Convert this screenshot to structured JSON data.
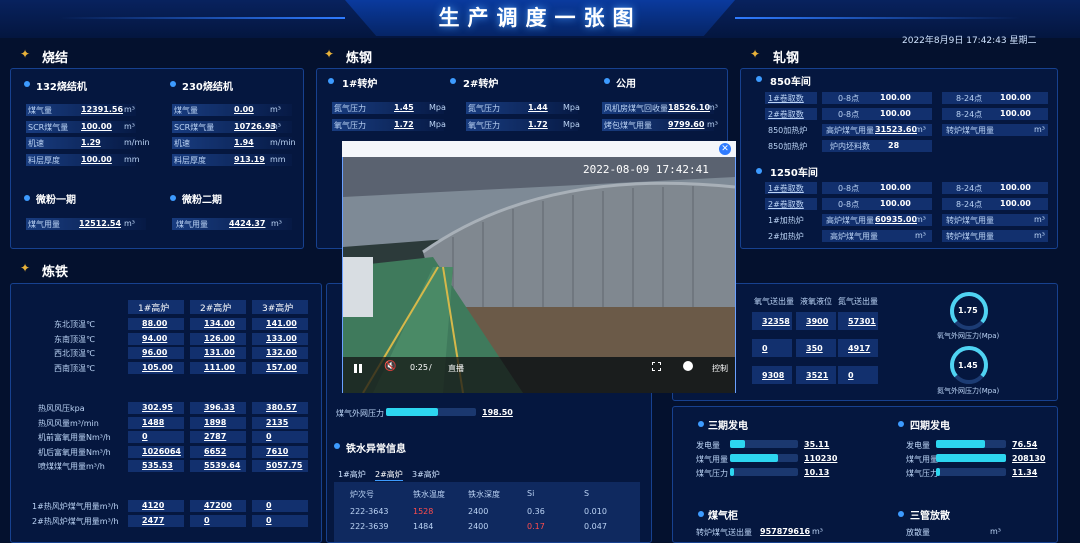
{
  "title": "生产调度一张图",
  "datetime": "2022年8月9日 17:42:43 星期二",
  "sinter": {
    "title": "烧结",
    "m132": {
      "title": "132烧结机",
      "rows": [
        {
          "l": "煤气量",
          "v": "12391.56",
          "u": "m³"
        },
        {
          "l": "SCR煤气量",
          "v": "100.00",
          "u": "m³"
        },
        {
          "l": "机速",
          "v": "1.29",
          "u": "m/min"
        },
        {
          "l": "料层厚度",
          "v": "100.00",
          "u": "mm"
        }
      ]
    },
    "m230": {
      "title": "230烧结机",
      "rows": [
        {
          "l": "煤气量",
          "v": "0.00",
          "u": "m³"
        },
        {
          "l": "SCR煤气量",
          "v": "10726.93",
          "u": "m³"
        },
        {
          "l": "机速",
          "v": "1.94",
          "u": "m/min"
        },
        {
          "l": "料层厚度",
          "v": "913.19",
          "u": "mm"
        }
      ]
    },
    "w1": {
      "title": "微粉一期",
      "l": "煤气用量",
      "v": "12512.54",
      "u": "m³"
    },
    "w2": {
      "title": "微粉二期",
      "l": "煤气用量",
      "v": "4424.37",
      "u": "m³"
    }
  },
  "steel": {
    "title": "炼钢",
    "c1": {
      "title": "1#转炉",
      "rows": [
        {
          "l": "氮气压力",
          "v": "1.45",
          "u": "Mpa"
        },
        {
          "l": "氧气压力",
          "v": "1.72",
          "u": "Mpa"
        }
      ]
    },
    "c2": {
      "title": "2#转炉",
      "rows": [
        {
          "l": "氮气压力",
          "v": "1.44",
          "u": "Mpa"
        },
        {
          "l": "氧气压力",
          "v": "1.72",
          "u": "Mpa"
        }
      ]
    },
    "pub": {
      "title": "公用",
      "rows": [
        {
          "l": "风机房煤气回收量",
          "v": "18526.10",
          "u": "m³"
        },
        {
          "l": "烤包煤气用量",
          "v": "9799.60",
          "u": "m³"
        }
      ]
    }
  },
  "roll": {
    "title": "轧钢",
    "w850": {
      "title": "850车间",
      "rows": [
        {
          "a": "1#卷取数",
          "b": "0-8点",
          "c": "100.00",
          "d": "8-24点",
          "e": "100.00"
        },
        {
          "a": "2#卷取数",
          "b": "0-8点",
          "c": "100.00",
          "d": "8-24点",
          "e": "100.00"
        }
      ],
      "r3": {
        "a": "850加热炉",
        "b": "高炉煤气用量",
        "c": "31523.60",
        "u": "m³",
        "d": "转炉煤气用量",
        "u2": "m³"
      },
      "r4": {
        "a": "850加热炉",
        "b": "炉内坯料数",
        "c": "28"
      }
    },
    "w1250": {
      "title": "1250车间",
      "rows": [
        {
          "a": "1#卷取数",
          "b": "0-8点",
          "c": "100.00",
          "d": "8-24点",
          "e": "100.00"
        },
        {
          "a": "2#卷取数",
          "b": "0-8点",
          "c": "100.00",
          "d": "8-24点",
          "e": "100.00"
        }
      ],
      "r3": {
        "a": "1#加热炉",
        "b": "高炉煤气用量",
        "c": "60935.00",
        "u": "m³",
        "d": "转炉煤气用量",
        "u2": "m³"
      },
      "r4": {
        "a": "2#加热炉",
        "b": "高炉煤气用量",
        "u": "m³",
        "d": "转炉煤气用量",
        "u2": "m³"
      }
    }
  },
  "iron": {
    "title": "炼铁",
    "heads": [
      "1#高炉",
      "2#高炉",
      "3#高炉"
    ],
    "t1": [
      {
        "l": "东北顶温℃",
        "v": [
          "88.00",
          "134.00",
          "141.00"
        ]
      },
      {
        "l": "东南顶温℃",
        "v": [
          "94.00",
          "126.00",
          "133.00"
        ]
      },
      {
        "l": "西北顶温℃",
        "v": [
          "96.00",
          "131.00",
          "132.00"
        ]
      },
      {
        "l": "西南顶温℃",
        "v": [
          "105.00",
          "111.00",
          "157.00"
        ]
      }
    ],
    "t2": [
      {
        "l": "热风风压kpa",
        "v": [
          "302.95",
          "396.33",
          "380.57"
        ]
      },
      {
        "l": "热风风量m³/min",
        "v": [
          "1488",
          "1898",
          "2135"
        ]
      },
      {
        "l": "机前富氧用量Nm³/h",
        "v": [
          "0",
          "2787",
          "0"
        ]
      },
      {
        "l": "机后富氧用量Nm³/h",
        "v": [
          "1026064",
          "6652",
          "7610"
        ]
      },
      {
        "l": "喷煤煤气用量m³/h",
        "v": [
          "535.53",
          "5539.64",
          "5057.75"
        ]
      }
    ],
    "t3": [
      {
        "l": "1#热风炉煤气用量m³/h",
        "v": [
          "4120",
          "47200",
          "0"
        ]
      },
      {
        "l": "2#热风炉煤气用量m³/h",
        "v": [
          "2477",
          "0",
          "0"
        ]
      }
    ]
  },
  "gas": {
    "label": "煤气外网压力",
    "value": "198.50",
    "fill": 0.58
  },
  "iron_abn": {
    "title": "铁水异常信息",
    "tabs": [
      "1#高炉",
      "2#高炉",
      "3#高炉"
    ],
    "cols": [
      "炉次号",
      "铁水温度",
      "铁水深度",
      "Si",
      "S"
    ],
    "rows": [
      [
        "222-3643",
        "1528",
        "2400",
        "0.36",
        "0.010"
      ],
      [
        "222-3639",
        "1484",
        "2400",
        "0.17",
        "0.047"
      ]
    ]
  },
  "oxy": {
    "heads": [
      "氧气送出量",
      "液氧液位",
      "氮气送出量"
    ],
    "rows": [
      [
        "32358",
        "3900",
        "57301"
      ],
      [
        "0",
        "350",
        "4917"
      ],
      [
        "9308",
        "3521",
        "0"
      ]
    ],
    "g1": {
      "v": "1.75",
      "l": "氧气外网压力(Mpa)"
    },
    "g2": {
      "v": "1.45",
      "l": "氮气外网压力(Mpa)"
    }
  },
  "power": {
    "p3": {
      "title": "三期发电",
      "rows": [
        {
          "l": "发电量",
          "v": "35.11",
          "f": 0.22
        },
        {
          "l": "煤气用量",
          "v": "110230",
          "f": 0.7
        },
        {
          "l": "煤气压力",
          "v": "10.13",
          "f": 0.06
        }
      ]
    },
    "p4": {
      "title": "四期发电",
      "rows": [
        {
          "l": "发电量",
          "v": "76.54",
          "f": 0.7
        },
        {
          "l": "煤气用量",
          "v": "208130",
          "f": 1.0
        },
        {
          "l": "煤气压力",
          "v": "11.34",
          "f": 0.06
        }
      ]
    },
    "holder": {
      "title": "煤气柜",
      "l": "转炉煤气送出量",
      "v": "957879616",
      "u": "m³"
    },
    "flare": {
      "title": "三管放散",
      "l": "放散量",
      "u": "m³"
    }
  },
  "video": {
    "timestamp": "2022-08-09 17:42:41",
    "time": "0:25",
    "sep": "/",
    "live": "直播",
    "ptz": "控制"
  }
}
